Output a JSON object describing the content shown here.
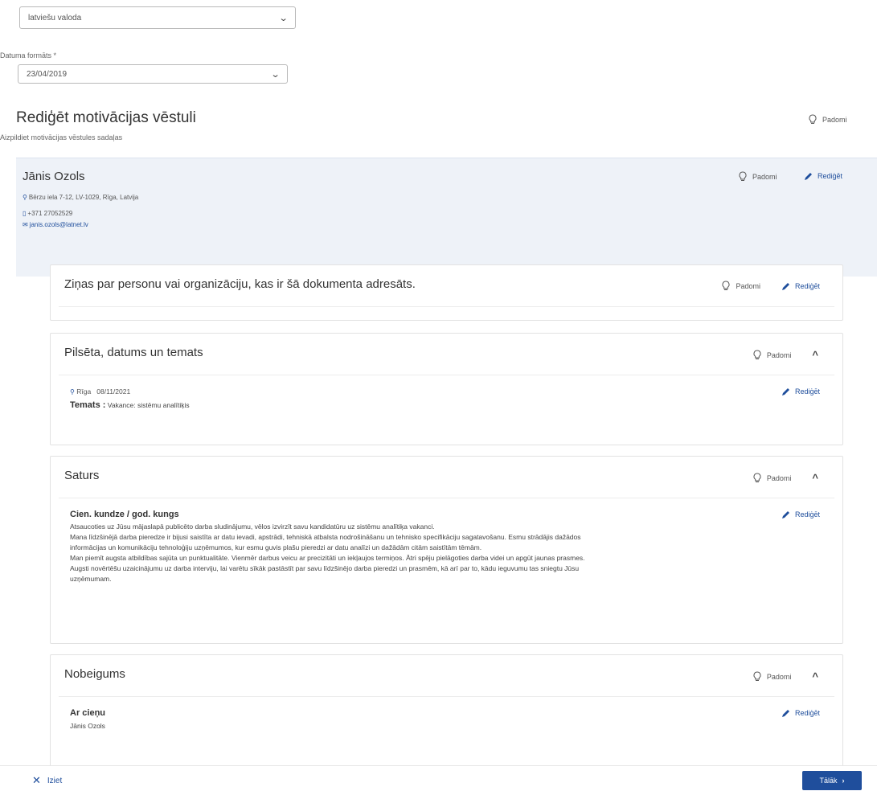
{
  "language_select": {
    "value": "latviešu valoda"
  },
  "date_format": {
    "label": "Datuma formāts *",
    "value": "23/04/2019"
  },
  "header": {
    "title": "Rediģēt motivācijas vēstuli",
    "subtitle": "Aizpildiet motivācijas vēstules sadaļas",
    "tips_label": "Padomi"
  },
  "contact": {
    "name": "Jānis Ozols",
    "address": "Bērzu iela 7-12, LV-1029, Rīga, Latvija",
    "phone": "+371 27052529",
    "email": "janis.ozols@latnet.lv",
    "tips_label": "Padomi",
    "edit_label": "Rediģēt"
  },
  "sections": {
    "recipient": {
      "title": "Ziņas par personu vai organizāciju, kas ir šā dokumenta adresāts.",
      "tips_label": "Padomi",
      "edit_label": "Rediģēt"
    },
    "city_date": {
      "title": "Pilsēta, datums un temats",
      "tips_label": "Padomi",
      "city": "Rīga",
      "date": "08/11/2021",
      "subject_label": "Temats :",
      "subject_value": "Vakance: sistēmu analītiķis",
      "edit_label": "Rediģēt"
    },
    "content": {
      "title": "Saturs",
      "tips_label": "Padomi",
      "salutation": "Cien. kundze / god. kungs",
      "edit_label": "Rediģēt",
      "lines": [
        "Atsaucoties uz Jūsu mājaslapā publicēto darba sludinājumu, vēlos izvirzīt savu kandidatūru uz sistēmu analītiķa vakanci.",
        "Mana līdzšinējā darba pieredze ir bijusi saistīta ar datu ievadi, apstrādi, tehniskā atbalsta nodrošināšanu un tehnisko specifikāciju sagatavošanu. Esmu strādājis dažādos",
        "informācijas un komunikāciju tehnoloģiju uzņēmumos, kur esmu guvis plašu pieredzi ar datu analīzi un dažādām citām saistītām tēmām.",
        "Man piemīt augsta atbildības sajūta un punktualitāte. Vienmēr darbus veicu ar precizitāti un iekļaujos termiņos. Ātri spēju pielāgoties darba videi un apgūt jaunas prasmes.",
        "Augsti novērtēšu uzaicinājumu uz darba interviju, lai varētu sīkāk pastāstīt par savu līdzšinējo darba pieredzi un prasmēm, kā arī par to, kādu ieguvumu tas sniegtu Jūsu",
        "uzņēmumam."
      ]
    },
    "closing": {
      "title": "Nobeigums",
      "tips_label": "Padomi",
      "sign_off": "Ar cieņu",
      "signer": "Jānis Ozols",
      "edit_label": "Rediģēt"
    }
  },
  "footer": {
    "cancel_label": "Iziet",
    "next_label": "Tālāk"
  }
}
